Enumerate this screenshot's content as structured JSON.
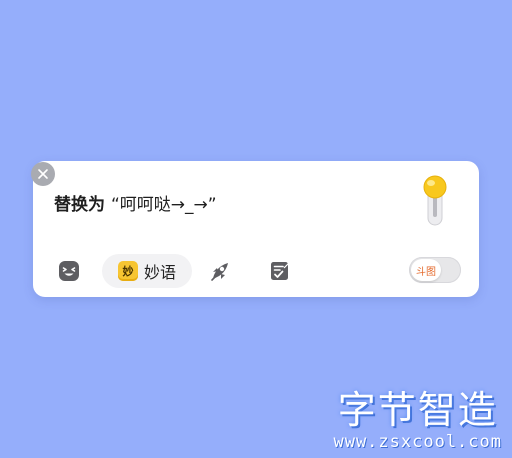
{
  "replace": {
    "label": "替换为",
    "value": "“呵呵哒→_→”"
  },
  "toolbar": {
    "miaoyu_badge": "妙",
    "miaoyu_label": "妙语",
    "doutu_label": "斗图"
  },
  "watermark": {
    "title": "字节智造",
    "url": "www.zsxcool.com"
  },
  "colors": {
    "background": "#95aefb",
    "card": "#ffffff",
    "accent_yellow": "#f7c532",
    "icon_gray": "#5e5e62",
    "doutu_orange": "#e46a2c"
  },
  "icons": {
    "close": "close-icon",
    "toggle": "lightbulb-toggle-icon",
    "emoji": "smiley-face-icon",
    "rocket": "rocket-icon",
    "edit": "checklist-edit-icon"
  }
}
